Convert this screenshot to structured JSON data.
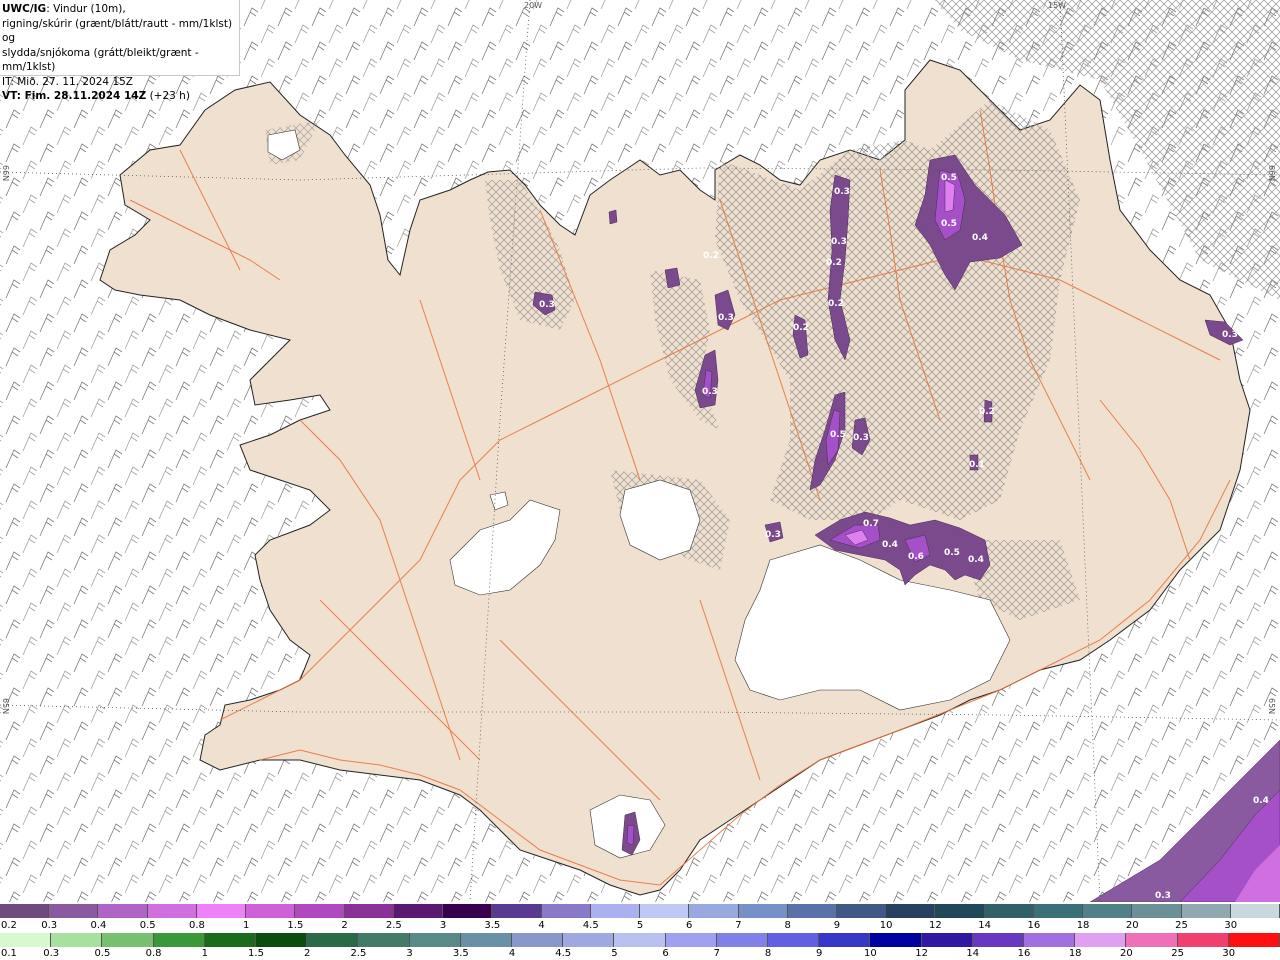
{
  "title": {
    "model": "UWC/IG",
    "line1_rest": ": Vindur (10m),",
    "line2": "rigning/skúrir (grænt/blátt/rautt - mm/1klst) og",
    "line3": "slydda/snjókoma (grátt/bleikt/grænt - mm/1klst)",
    "it": "IT: Mið. 27. 11. 2024 15Z",
    "vt_label": "VT: Fim. 28.11.2024 14Z",
    "vt_offset": " (+23 h)"
  },
  "grid_labels": {
    "lon_20w": "20W",
    "lon_15w": "15W",
    "lat_66n_left": "66N",
    "lat_66n_right": "66N",
    "lat_65n_left": "65N",
    "lat_65n_right": "65N"
  },
  "precip_labels": [
    "0.5",
    "0.5",
    "0.4",
    "0.3",
    "0.3",
    "0.2",
    "0.2",
    "0.3",
    "0.2",
    "0.3",
    "0.3",
    "0.2",
    "0.5",
    "0.3",
    "0.2",
    "0.1",
    "0.7",
    "0.4",
    "0.6",
    "0.5",
    "0.4",
    "0.3",
    "0.3",
    "0.4",
    "0.3"
  ],
  "colors": {
    "land": "#f0e0d0",
    "roads": "#e8743c",
    "coast": "#222222",
    "sea": "#ffffff",
    "barbs": "#555555",
    "glacier": "#ffffff",
    "snow_dark": "#7a4a8c",
    "snow_mid": "#a550c8",
    "snow_light": "#e080f0"
  },
  "snow_scale": {
    "ticks": [
      "0.2",
      "0.3",
      "0.4",
      "0.5",
      "0.8",
      "1",
      "1.5",
      "2",
      "2.5",
      "3",
      "3.5",
      "4",
      "4.5",
      "5",
      "6",
      "7",
      "8",
      "9",
      "10",
      "12",
      "14",
      "16",
      "18",
      "20",
      "25",
      "30"
    ],
    "colors": [
      "#6e4a7e",
      "#8a5aa0",
      "#b064c8",
      "#d070e0",
      "#f080f8",
      "#d060d8",
      "#b048c0",
      "#8a3098",
      "#5a1870",
      "#3a0050",
      "#5a3a90",
      "#8a78c8",
      "#aab0f0",
      "#c0c8f8",
      "#98a8e0",
      "#7890c8",
      "#5a70a8",
      "#405888",
      "#284060",
      "#204858",
      "#306068",
      "#3a7078",
      "#508088",
      "#6c9098",
      "#90a8b0",
      "#c8d8dc"
    ]
  },
  "rain_scale": {
    "ticks": [
      "0.1",
      "0.3",
      "0.5",
      "0.8",
      "1",
      "1.5",
      "2",
      "2.5",
      "3",
      "3.5",
      "4",
      "4.5",
      "5",
      "6",
      "7",
      "8",
      "9",
      "10",
      "12",
      "14",
      "16",
      "18",
      "20",
      "25",
      "30"
    ],
    "colors": [
      "#d8f8d0",
      "#a8e0a0",
      "#78c070",
      "#3a9838",
      "#1a6c1a",
      "#0c4c10",
      "#2a6a48",
      "#447a68",
      "#5a8a88",
      "#6a90a8",
      "#8898c8",
      "#a0a8e0",
      "#b8c0f0",
      "#a0a0f0",
      "#8080e8",
      "#6060e0",
      "#3838c8",
      "#0000a0",
      "#3018a0",
      "#6838c0",
      "#a070e0",
      "#e0a0f0",
      "#f070b8",
      "#f04070",
      "#ff1010"
    ]
  }
}
